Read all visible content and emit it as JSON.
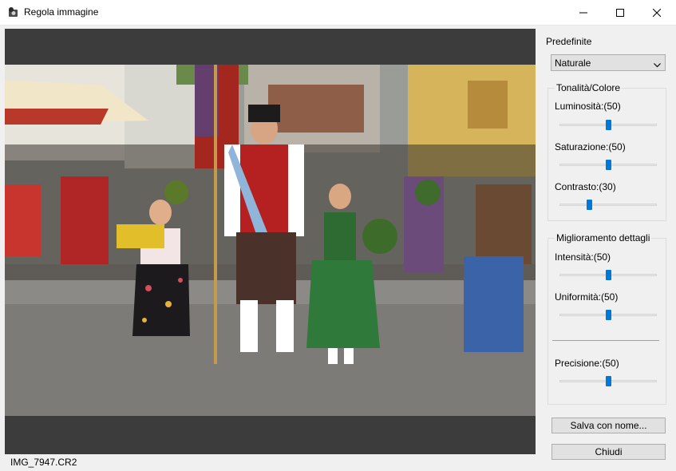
{
  "window": {
    "title": "Regola immagine",
    "icons": {
      "app": "app-icon",
      "minimize": "minimize-icon",
      "maximize": "maximize-icon",
      "close": "close-icon"
    }
  },
  "image": {
    "filename": "IMG_7947.CR2"
  },
  "panel": {
    "presets_label": "Predefinite",
    "preset_value": "Naturale",
    "tone_group": {
      "title": "Tonalità/Colore",
      "sliders": [
        {
          "label": "Luminosità:(50)",
          "value": 50
        },
        {
          "label": "Saturazione:(50)",
          "value": 50
        },
        {
          "label": "Contrasto:(30)",
          "value": 30
        }
      ]
    },
    "detail_group": {
      "title": "Miglioramento dettagli",
      "sliders": [
        {
          "label": "Intensità:(50)",
          "value": 50
        },
        {
          "label": "Uniformità:(50)",
          "value": 50
        },
        {
          "label": "Precisione:(50)",
          "value": 50
        }
      ]
    },
    "slider_range": [
      0,
      100
    ],
    "accent_color": "#0078d7",
    "save_as_label": "Salva con nome...",
    "close_label": "Chiudi"
  }
}
